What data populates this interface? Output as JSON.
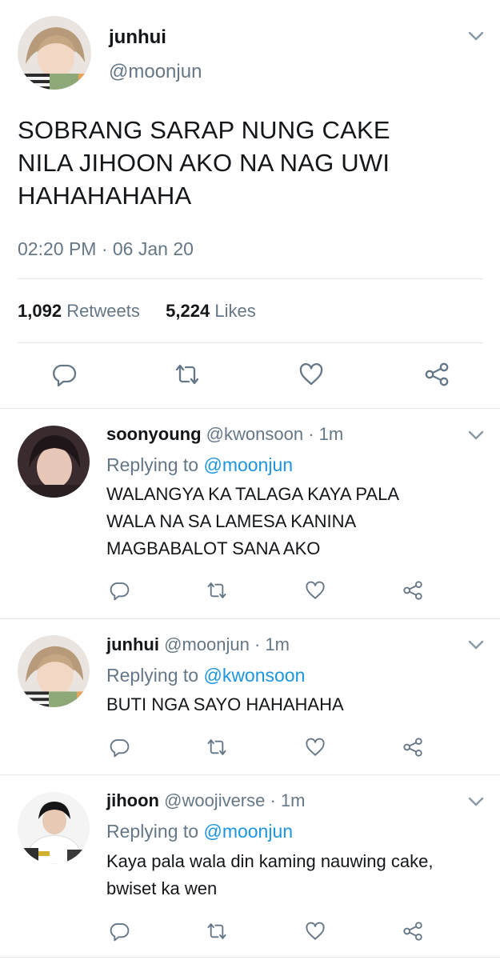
{
  "main_tweet": {
    "author_name": "junhui",
    "author_handle": "@moonjun",
    "text_lines": [
      "SOBRANG SARAP NUNG CAKE",
      "NILA JIHOON AKO NA NAG UWI",
      "HAHAHAHAHA"
    ],
    "timestamp": "02:20 PM · 06 Jan 20",
    "retweets_count": "1,092",
    "retweets_label": "Retweets",
    "likes_count": "5,224",
    "likes_label": "Likes"
  },
  "replies": [
    {
      "name": "soonyoung",
      "handle": "@kwonsoon",
      "time": "· 1m",
      "replying_label": "Replying to",
      "replying_to": "@moonjun",
      "text_lines": [
        "WALANGYA KA TALAGA KAYA PALA",
        "WALA NA SA LAMESA KANINA",
        "MAGBABALOT SANA AKO"
      ]
    },
    {
      "name": "junhui",
      "handle": "@moonjun",
      "time": "· 1m",
      "replying_label": "Replying to",
      "replying_to": "@kwonsoon",
      "text_lines": [
        "BUTI NGA SAYO HAHAHAHA"
      ]
    },
    {
      "name": "jihoon",
      "handle": "@woojiverse",
      "time": "· 1m",
      "replying_label": "Replying to",
      "replying_to": "@moonjun",
      "text_lines": [
        "Kaya pala wala din kaming nauwing cake,",
        "bwiset ka wen"
      ]
    }
  ],
  "icons": [
    "chevron-down-icon",
    "reply-icon",
    "retweet-icon",
    "like-icon",
    "share-icon"
  ],
  "colors": {
    "text": "#14171a",
    "muted": "#657786",
    "link": "#1b95e0",
    "divider": "#e1e8ed"
  }
}
